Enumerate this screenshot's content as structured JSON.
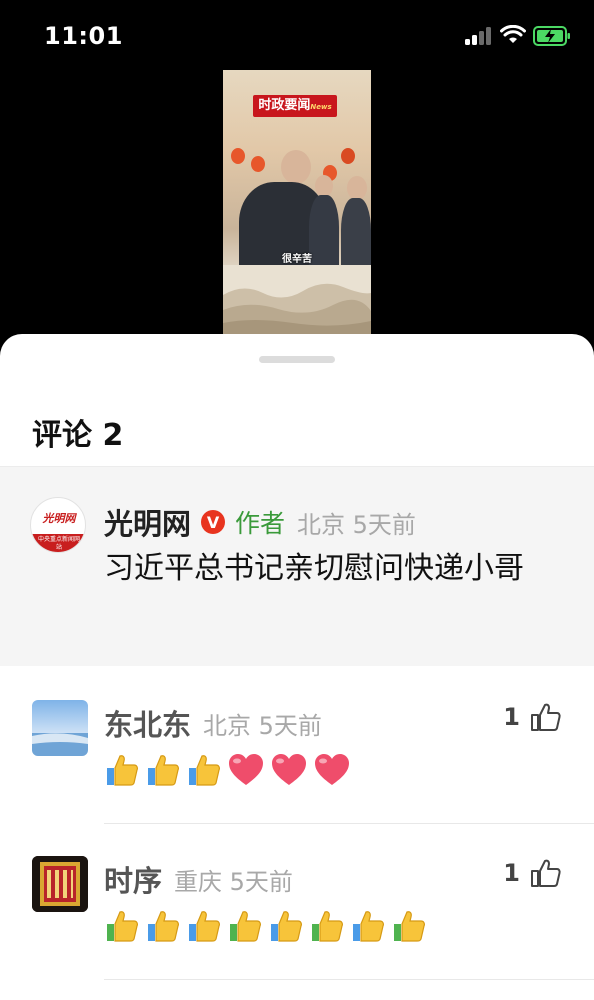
{
  "status": {
    "time": "11:01"
  },
  "video": {
    "banner": "时政要闻",
    "banner_suffix": "News",
    "caption": "很辛苦"
  },
  "sheet": {
    "title": "评论 2",
    "pinned": {
      "name": "光明网",
      "badge": "V",
      "author_tag": "作者",
      "meta": "北京 5天前",
      "avatar_text": "光明网",
      "avatar_sub": "中央重点新闻网站",
      "text": "习近平总书记亲切慰问快递小哥"
    },
    "comments": [
      {
        "name": "东北东",
        "meta": "北京 5天前",
        "likes": "1",
        "emoji": [
          "thumbs-up",
          "thumbs-up",
          "thumbs-up",
          "heart",
          "heart",
          "heart"
        ]
      },
      {
        "name": "时序",
        "meta": "重庆 5天前",
        "likes": "1",
        "emoji": [
          "thumbs-up",
          "thumbs-up",
          "thumbs-up",
          "thumbs-up",
          "thumbs-up",
          "thumbs-up",
          "thumbs-up",
          "thumbs-up"
        ]
      }
    ]
  },
  "colors": {
    "author_green": "#3a9a3a",
    "badge_red": "#e8341f",
    "meta_gray": "#a8a8a8"
  }
}
